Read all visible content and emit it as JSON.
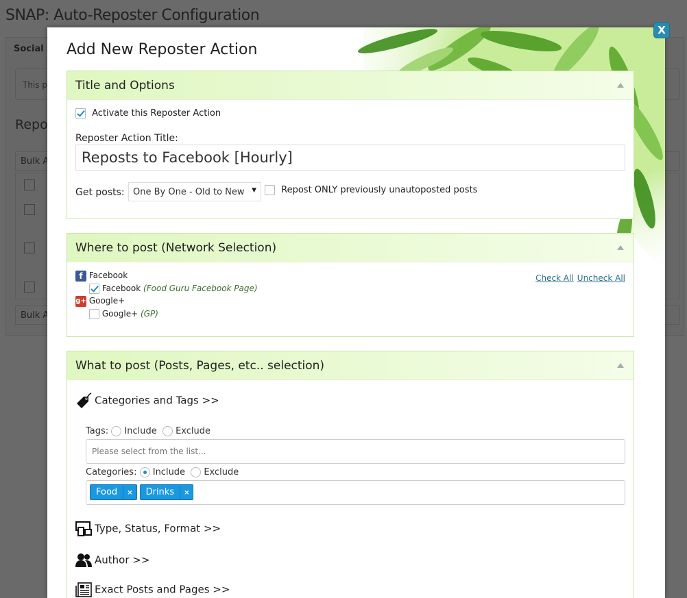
{
  "background": {
    "page_title": "SNAP: Auto-Reposter Configuration",
    "tab_label": "Social N",
    "notice_text": "This p",
    "section_heading": "Repo",
    "bulk_top": "Bulk A",
    "bulk_bottom": "Bulk A"
  },
  "modal": {
    "title": "Add New Reposter Action",
    "close_label": "X",
    "title_options": {
      "header": "Title and Options",
      "activate_label": "Activate this Reposter Action",
      "activate_checked": true,
      "action_title_label": "Reposter Action Title:",
      "action_title_value": "Reposts to Facebook [Hourly]",
      "get_posts_label": "Get posts:",
      "get_posts_value": "One By One - Old to New",
      "repost_only_label": "Repost ONLY previously unautoposted posts",
      "repost_only_checked": false
    },
    "where": {
      "header": "Where to post (Network Selection)",
      "check_all": "Check All",
      "uncheck_all": "Uncheck All",
      "networks": [
        {
          "name": "Facebook",
          "icon": "facebook-icon",
          "color": "#3b5998",
          "account": "Facebook",
          "account_detail": "(Food Guru Facebook Page)",
          "checked": true
        },
        {
          "name": "Google+",
          "icon": "google-plus-icon",
          "color": "#c9402e",
          "account": "Google+",
          "account_detail": "(GP)",
          "checked": false
        }
      ]
    },
    "what": {
      "header": "What to post (Posts, Pages, etc.. selection)",
      "categories_tags": "Categories and Tags  >>",
      "tags_label": "Tags:",
      "include": "Include",
      "exclude": "Exclude",
      "tags_placeholder": "Please select from the list...",
      "tags_mode": "none",
      "categories_label": "Categories:",
      "categories_mode": "include",
      "categories": [
        "Food",
        "Drinks"
      ],
      "chip_remove": "×",
      "type_status_format": "Type, Status, Format  >>",
      "author": "Author  >>",
      "exact_posts": "Exact Posts and Pages  >>"
    }
  },
  "colors": {
    "accent": "#1e8cbe",
    "chip": "#1a98e0",
    "box_header": "#dff7c0",
    "close": "#2a8bb0"
  }
}
